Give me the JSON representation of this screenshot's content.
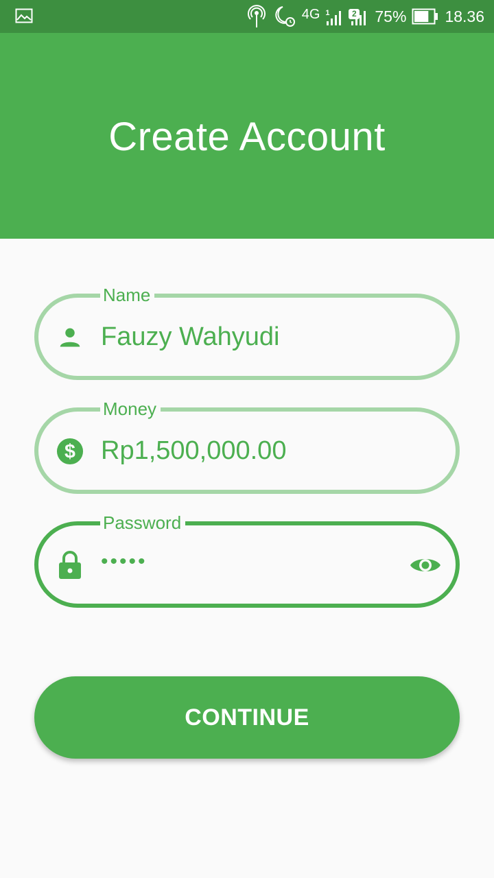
{
  "status_bar": {
    "network_type": "4G",
    "sim1_label": "1",
    "sim2_label": "2",
    "battery_percent": "75%",
    "battery_level": 0.75,
    "time": "18.36",
    "icons": [
      "gallery-icon",
      "hotspot-icon",
      "do-not-disturb-alarm-icon",
      "signal-icon",
      "battery-icon"
    ]
  },
  "header": {
    "title": "Create Account",
    "background_color": "#4caf50"
  },
  "form": {
    "name": {
      "label": "Name",
      "value": "Fauzy Wahyudi",
      "icon": "person-icon"
    },
    "money": {
      "label": "Money",
      "value": "Rp1,500,000.00",
      "icon": "dollar-icon"
    },
    "password": {
      "label": "Password",
      "value": "•••••",
      "icon": "lock-icon",
      "toggle_icon": "eye-icon",
      "focused": true
    }
  },
  "continue_button": {
    "label": "CONTINUE"
  },
  "colors": {
    "accent": "#4caf50",
    "field_border": "#a5d6a7",
    "status_bar": "#3d8f40"
  }
}
